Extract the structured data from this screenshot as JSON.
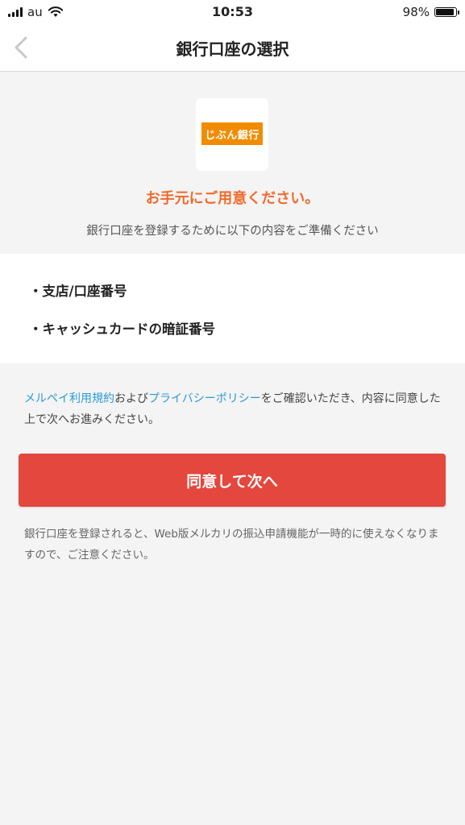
{
  "status_bar": {
    "carrier": "au",
    "time": "10:53",
    "battery_percent": "98%",
    "battery_level": 0.98,
    "signal_bars": 4
  },
  "nav": {
    "title": "銀行口座の選択",
    "back_icon": "chevron-left-icon"
  },
  "bank": {
    "logo_text": "じぶん銀行",
    "logo_color": "#f18c00"
  },
  "intro": {
    "heading": "お手元にご用意ください。",
    "description": "銀行口座を登録するために以下の内容をご準備ください"
  },
  "requirements": [
    "・支店/口座番号",
    "・キャッシュカードの暗証番号"
  ],
  "terms": {
    "link1": "メルペイ利用規約",
    "text1": "および",
    "link2": "プライバシーポリシー",
    "text2": "をご確認いただき、内容に同意した上で次へお進みください。"
  },
  "agree_button": "同意して次へ",
  "note": "銀行口座を登録されると、Web版メルカリの振込申請機能が一時的に使えなくなりますので、ご注意ください。",
  "colors": {
    "accent": "#e4473d",
    "heading": "#f06b2c",
    "link": "#2a9ad6"
  }
}
